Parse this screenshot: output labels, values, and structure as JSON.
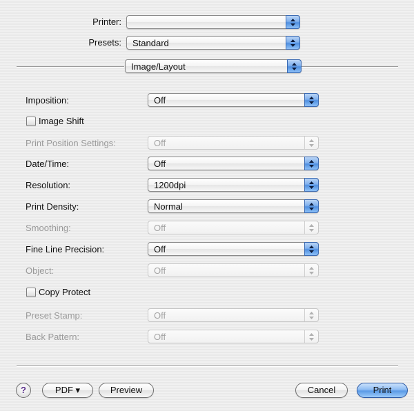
{
  "header": {
    "printer_label": "Printer:",
    "printer_value": "",
    "presets_label": "Presets:",
    "presets_value": "Standard",
    "panel_value": "Image/Layout"
  },
  "settings": {
    "imposition": {
      "label": "Imposition:",
      "value": "Off"
    },
    "image_shift": {
      "label": "Image Shift",
      "checked": false
    },
    "print_position": {
      "label": "Print Position Settings:",
      "value": "Off",
      "enabled": false
    },
    "date_time": {
      "label": "Date/Time:",
      "value": "Off"
    },
    "resolution": {
      "label": "Resolution:",
      "value": "1200dpi"
    },
    "print_density": {
      "label": "Print Density:",
      "value": "Normal"
    },
    "smoothing": {
      "label": "Smoothing:",
      "value": "Off",
      "enabled": false
    },
    "fine_line": {
      "label": "Fine Line Precision:",
      "value": "Off"
    },
    "object": {
      "label": "Object:",
      "value": "Off",
      "enabled": false
    },
    "copy_protect": {
      "label": "Copy Protect",
      "checked": false
    },
    "preset_stamp": {
      "label": "Preset Stamp:",
      "value": "Off",
      "enabled": false
    },
    "back_pattern": {
      "label": "Back Pattern:",
      "value": "Off",
      "enabled": false
    }
  },
  "footer": {
    "help_label": "?",
    "pdf_label": "PDF ▾",
    "preview_label": "Preview",
    "cancel_label": "Cancel",
    "print_label": "Print"
  },
  "colors": {
    "accent": "#5a9ae6",
    "disabled_text": "#9a9a9a"
  }
}
